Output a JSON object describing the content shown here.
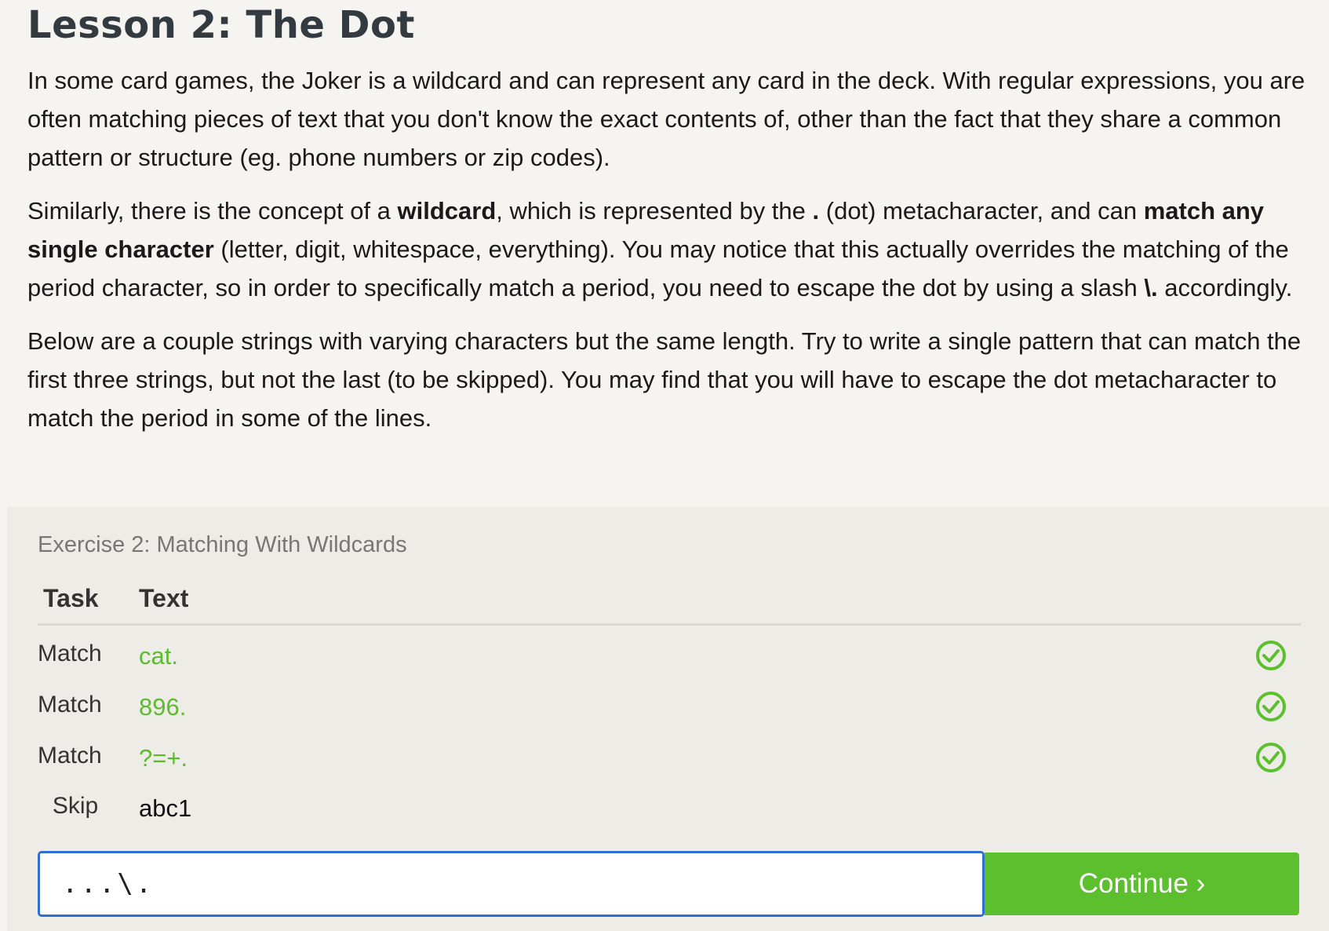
{
  "lesson": {
    "title": "Lesson 2: The Dot",
    "p1": "In some card games, the Joker is a wildcard and can represent any card in the deck. With regular expressions, you are often matching pieces of text that you don't know the exact contents of, other than the fact that they share a common pattern or structure (eg. phone numbers or zip codes).",
    "p2": {
      "t1": "Similarly, there is the concept of a ",
      "b1": "wildcard",
      "t2": ", which is represented by the ",
      "b2": ".",
      "t3": " (dot) metacharacter, and can ",
      "b3": "match any single character",
      "t4": " (letter, digit, whitespace, everything). You may notice that this actually overrides the matching of the period character, so in order to specifically match a period, you need to escape the dot by using a slash ",
      "b4": "\\.",
      "t5": " accordingly."
    },
    "p3": "Below are a couple strings with varying characters but the same length. Try to write a single pattern that can match the first three strings, but not the last (to be skipped). You may find that you will have to escape the dot metacharacter to match the period in some of the lines."
  },
  "exercise": {
    "title": "Exercise 2: Matching With Wildcards",
    "header_task": "Task",
    "header_text": "Text",
    "rows": [
      {
        "task": "Match",
        "text": "cat.",
        "status": "matched"
      },
      {
        "task": "Match",
        "text": "896.",
        "status": "matched"
      },
      {
        "task": "Match",
        "text": "?=+.",
        "status": "matched"
      },
      {
        "task": "Skip",
        "text": "abc1",
        "status": "none"
      }
    ],
    "input_value": "...\\.",
    "continue_label": "Continue ›",
    "colors": {
      "success": "#5cbf2e",
      "focus_border": "#2f6fd1"
    },
    "check_icon": "check-circle-icon"
  }
}
